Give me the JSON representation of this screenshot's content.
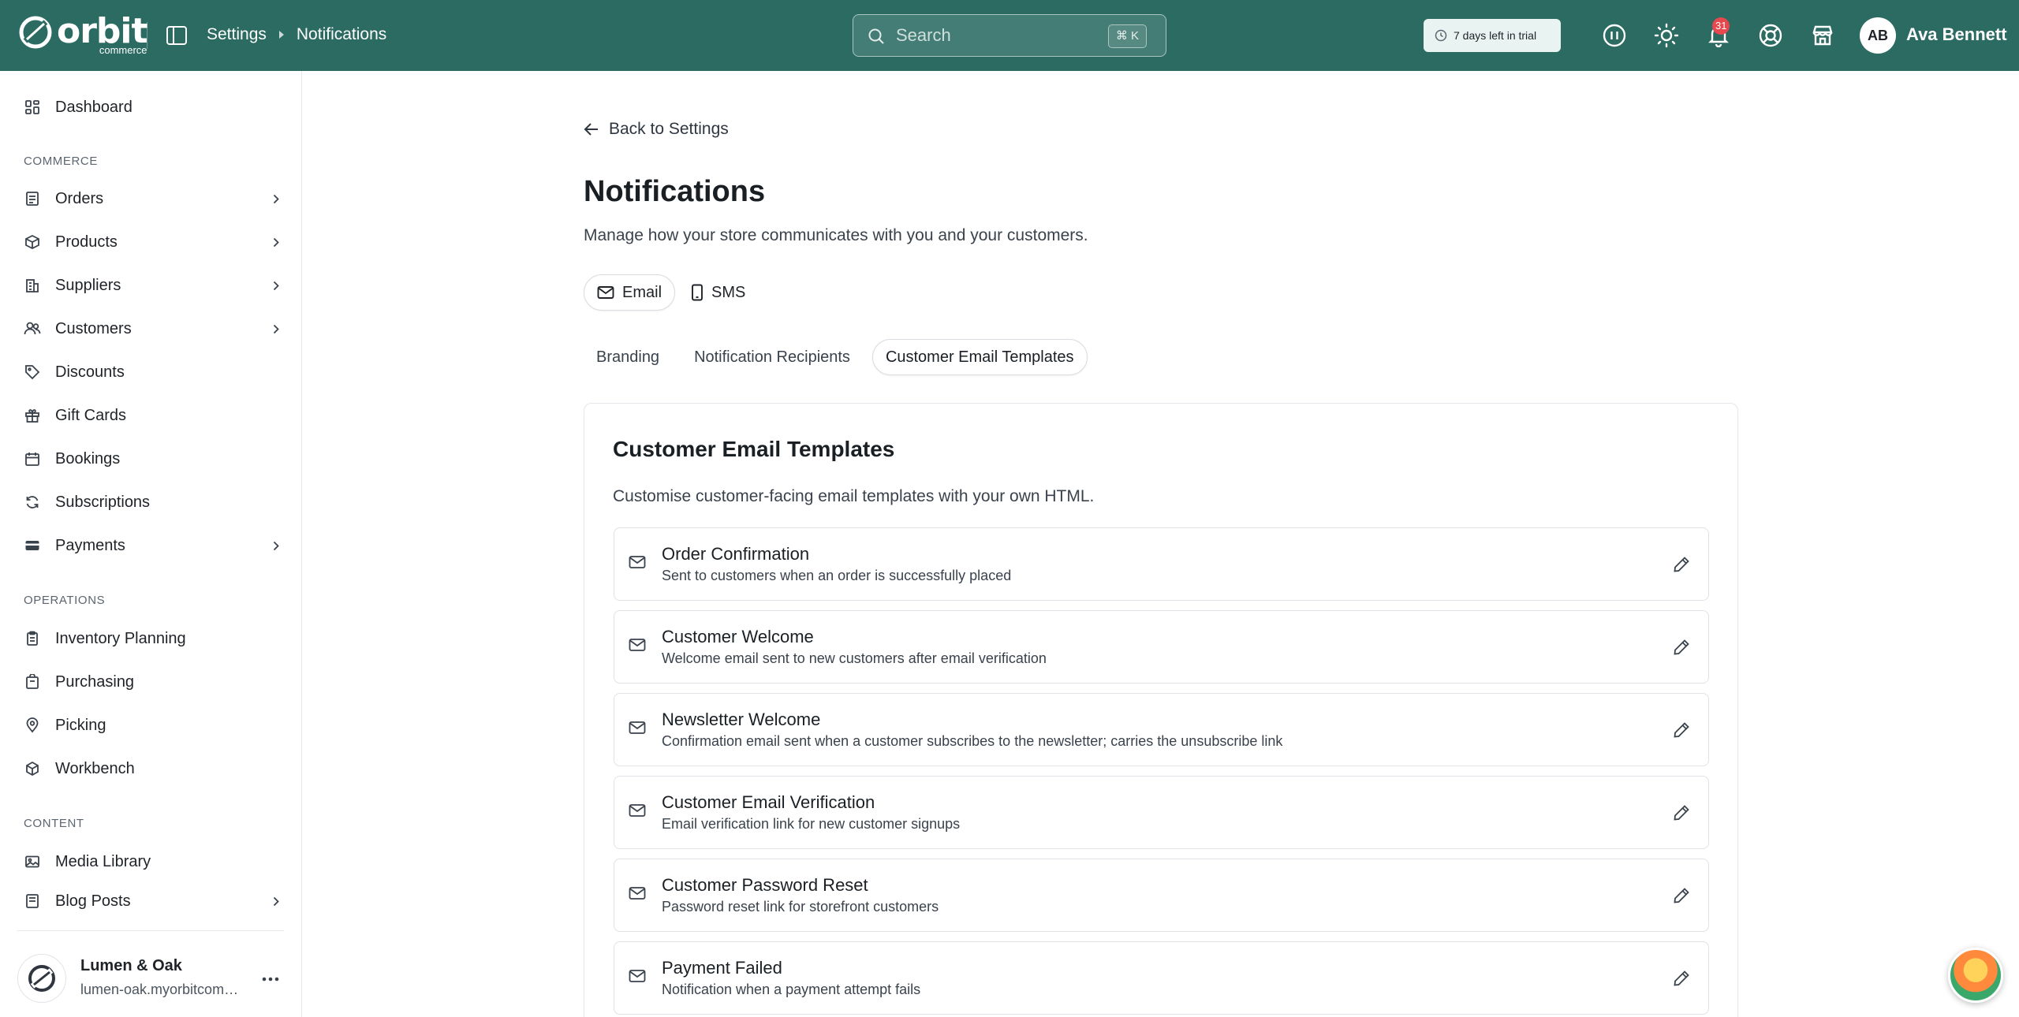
{
  "brand": {
    "name": "orbit",
    "sub": "commerce",
    "header_color": "#2b6b62"
  },
  "breadcrumb": {
    "parent": "Settings",
    "current": "Notifications"
  },
  "search": {
    "placeholder": "Search",
    "shortcut": "⌘ K"
  },
  "trial": {
    "label": "7 days left in trial"
  },
  "header_icons": [
    "pause-icon",
    "sun-icon",
    "bell-icon",
    "help-icon",
    "store-icon"
  ],
  "notifications": {
    "count": "31"
  },
  "user": {
    "initials": "AB",
    "name": "Ava Bennett"
  },
  "sidebar": {
    "dashboard": "Dashboard",
    "sections": {
      "commerce": "COMMERCE",
      "operations": "OPERATIONS",
      "content": "CONTENT"
    },
    "commerce_items": [
      {
        "label": "Orders",
        "icon": "orders-icon",
        "has_children": true
      },
      {
        "label": "Products",
        "icon": "box-icon",
        "has_children": true
      },
      {
        "label": "Suppliers",
        "icon": "building-icon",
        "has_children": true
      },
      {
        "label": "Customers",
        "icon": "users-icon",
        "has_children": true
      },
      {
        "label": "Discounts",
        "icon": "tag-icon",
        "has_children": false
      },
      {
        "label": "Gift Cards",
        "icon": "gift-icon",
        "has_children": false
      },
      {
        "label": "Bookings",
        "icon": "calendar-icon",
        "has_children": false
      },
      {
        "label": "Subscriptions",
        "icon": "refresh-icon",
        "has_children": false
      },
      {
        "label": "Payments",
        "icon": "card-icon",
        "has_children": true
      }
    ],
    "operations_items": [
      {
        "label": "Inventory Planning",
        "icon": "clipboard-icon"
      },
      {
        "label": "Purchasing",
        "icon": "cart-icon"
      },
      {
        "label": "Picking",
        "icon": "pin-icon"
      },
      {
        "label": "Workbench",
        "icon": "cube-icon"
      }
    ],
    "content_items": [
      {
        "label": "Media Library",
        "icon": "image-icon",
        "has_children": false
      },
      {
        "label": "Blog Posts",
        "icon": "doc-icon",
        "has_children": true
      }
    ],
    "store": {
      "name": "Lumen & Oak",
      "url": "lumen-oak.myorbitcommerce.com"
    }
  },
  "main": {
    "back_label": "Back to Settings",
    "title": "Notifications",
    "subtitle": "Manage how your store communicates with you and your customers.",
    "channel_tabs": [
      {
        "label": "Email",
        "active": true
      },
      {
        "label": "SMS",
        "active": false
      }
    ],
    "sub_tabs": [
      {
        "label": "Branding",
        "active": false
      },
      {
        "label": "Notification Recipients",
        "active": false
      },
      {
        "label": "Customer Email Templates",
        "active": true
      }
    ],
    "card": {
      "title": "Customer Email Templates",
      "subtitle": "Customise customer-facing email templates with your own HTML.",
      "templates": [
        {
          "name": "Order Confirmation",
          "desc": "Sent to customers when an order is successfully placed"
        },
        {
          "name": "Customer Welcome",
          "desc": "Welcome email sent to new customers after email verification"
        },
        {
          "name": "Newsletter Welcome",
          "desc": "Confirmation email sent when a customer subscribes to the newsletter; carries the unsubscribe link"
        },
        {
          "name": "Customer Email Verification",
          "desc": "Email verification link for new customer signups"
        },
        {
          "name": "Customer Password Reset",
          "desc": "Password reset link for storefront customers"
        },
        {
          "name": "Payment Failed",
          "desc": "Notification when a payment attempt fails"
        }
      ]
    }
  }
}
